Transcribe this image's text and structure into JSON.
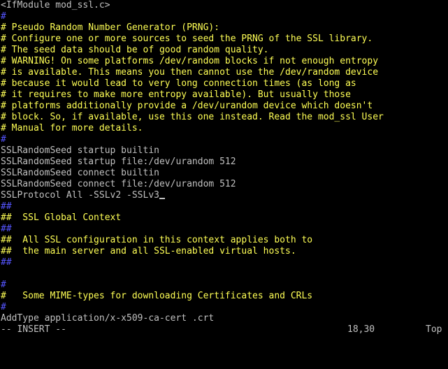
{
  "editor": {
    "lines": [
      {
        "text": "<IfModule mod_ssl.c>",
        "color": "#c0c0c0"
      },
      {
        "text": "#",
        "color": "#5555ff"
      },
      {
        "text": "# Pseudo Random Number Generator (PRNG):",
        "color": "#ffff55"
      },
      {
        "text": "# Configure one or more sources to seed the PRNG of the SSL library.",
        "color": "#ffff55"
      },
      {
        "text": "# The seed data should be of good random quality.",
        "color": "#ffff55"
      },
      {
        "text": "# WARNING! On some platforms /dev/random blocks if not enough entropy",
        "color": "#ffff55"
      },
      {
        "text": "# is available. This means you then cannot use the /dev/random device",
        "color": "#ffff55"
      },
      {
        "text": "# because it would lead to very long connection times (as long as",
        "color": "#ffff55"
      },
      {
        "text": "# it requires to make more entropy available). But usually those",
        "color": "#ffff55"
      },
      {
        "text": "# platforms additionally provide a /dev/urandom device which doesn't",
        "color": "#ffff55"
      },
      {
        "text": "# block. So, if available, use this one instead. Read the mod_ssl User",
        "color": "#ffff55"
      },
      {
        "text": "# Manual for more details.",
        "color": "#ffff55"
      },
      {
        "text": "#",
        "color": "#5555ff"
      },
      {
        "text": "SSLRandomSeed startup builtin",
        "color": "#c0c0c0"
      },
      {
        "text": "SSLRandomSeed startup file:/dev/urandom 512",
        "color": "#c0c0c0"
      },
      {
        "text": "SSLRandomSeed connect builtin",
        "color": "#c0c0c0"
      },
      {
        "text": "SSLRandomSeed connect file:/dev/urandom 512",
        "color": "#c0c0c0"
      },
      {
        "text": "SSLProtocol All -SSLv2 -SSLv3",
        "color": "#c0c0c0",
        "cursor": true
      },
      {
        "text": "##",
        "color": "#5555ff"
      },
      {
        "text": "##  SSL Global Context",
        "color": "#ffff55"
      },
      {
        "text": "##",
        "color": "#5555ff"
      },
      {
        "text": "##  All SSL configuration in this context applies both to",
        "color": "#ffff55"
      },
      {
        "text": "##  the main server and all SSL-enabled virtual hosts.",
        "color": "#ffff55"
      },
      {
        "text": "##",
        "color": "#5555ff"
      },
      {
        "text": "",
        "color": "#c0c0c0"
      },
      {
        "text": "#",
        "color": "#5555ff"
      },
      {
        "text": "#   Some MIME-types for downloading Certificates and CRLs",
        "color": "#ffff55"
      },
      {
        "text": "#",
        "color": "#5555ff"
      },
      {
        "text": "AddType application/x-x509-ca-cert .crt",
        "color": "#c0c0c0"
      }
    ]
  },
  "statusbar": {
    "mode": "-- INSERT --",
    "position": "18,30",
    "scroll": "Top"
  },
  "colors": {
    "background": "#000000",
    "text": "#c0c0c0",
    "comment_marker": "#5555ff",
    "comment_text": "#ffff55"
  }
}
